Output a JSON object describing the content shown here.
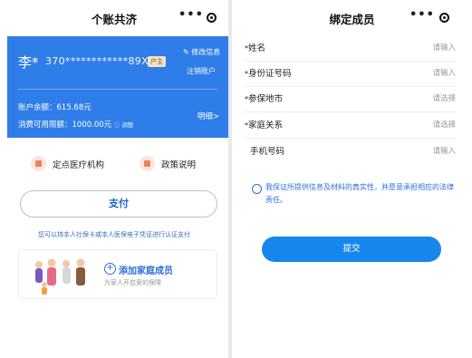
{
  "left": {
    "title": "个账共济",
    "card": {
      "name": "李*",
      "id_masked": "370************89X",
      "tag": "户主",
      "edit": "修改信息",
      "cancel": "注销账户",
      "balance": "账户余额：615.68元",
      "limit": "消费可用限额：1000.00元",
      "limit_suffix": "ⓘ 调整",
      "detail": "明细>"
    },
    "quick": [
      {
        "label": "定点医疗机构"
      },
      {
        "label": "政策说明"
      }
    ],
    "pay_label": "支付",
    "hint": "您可以持本人社保卡或本人医保电子凭证进行认证支付",
    "family": {
      "title": "添加家庭成员",
      "subtitle": "为家人开启爱的保障"
    }
  },
  "right": {
    "title": "绑定成员",
    "fields": [
      {
        "label": "姓名",
        "required": "*",
        "value": "请输入"
      },
      {
        "label": "身份证号码",
        "required": "*",
        "value": "请输入"
      },
      {
        "label": "参保地市",
        "required": "*",
        "value": "请选择"
      },
      {
        "label": "家庭关系",
        "required": "*",
        "value": "请选择"
      },
      {
        "label": "手机号码",
        "required": "",
        "value": "请输入"
      }
    ],
    "agreement": "我保证所提供信息及材料的真实性，并愿意承担相应的法律责任。",
    "submit_label": "提交"
  },
  "colors": {
    "card_blue": "#2f7de8",
    "link_blue": "#2d6ed9",
    "submit_blue": "#1787ee"
  }
}
